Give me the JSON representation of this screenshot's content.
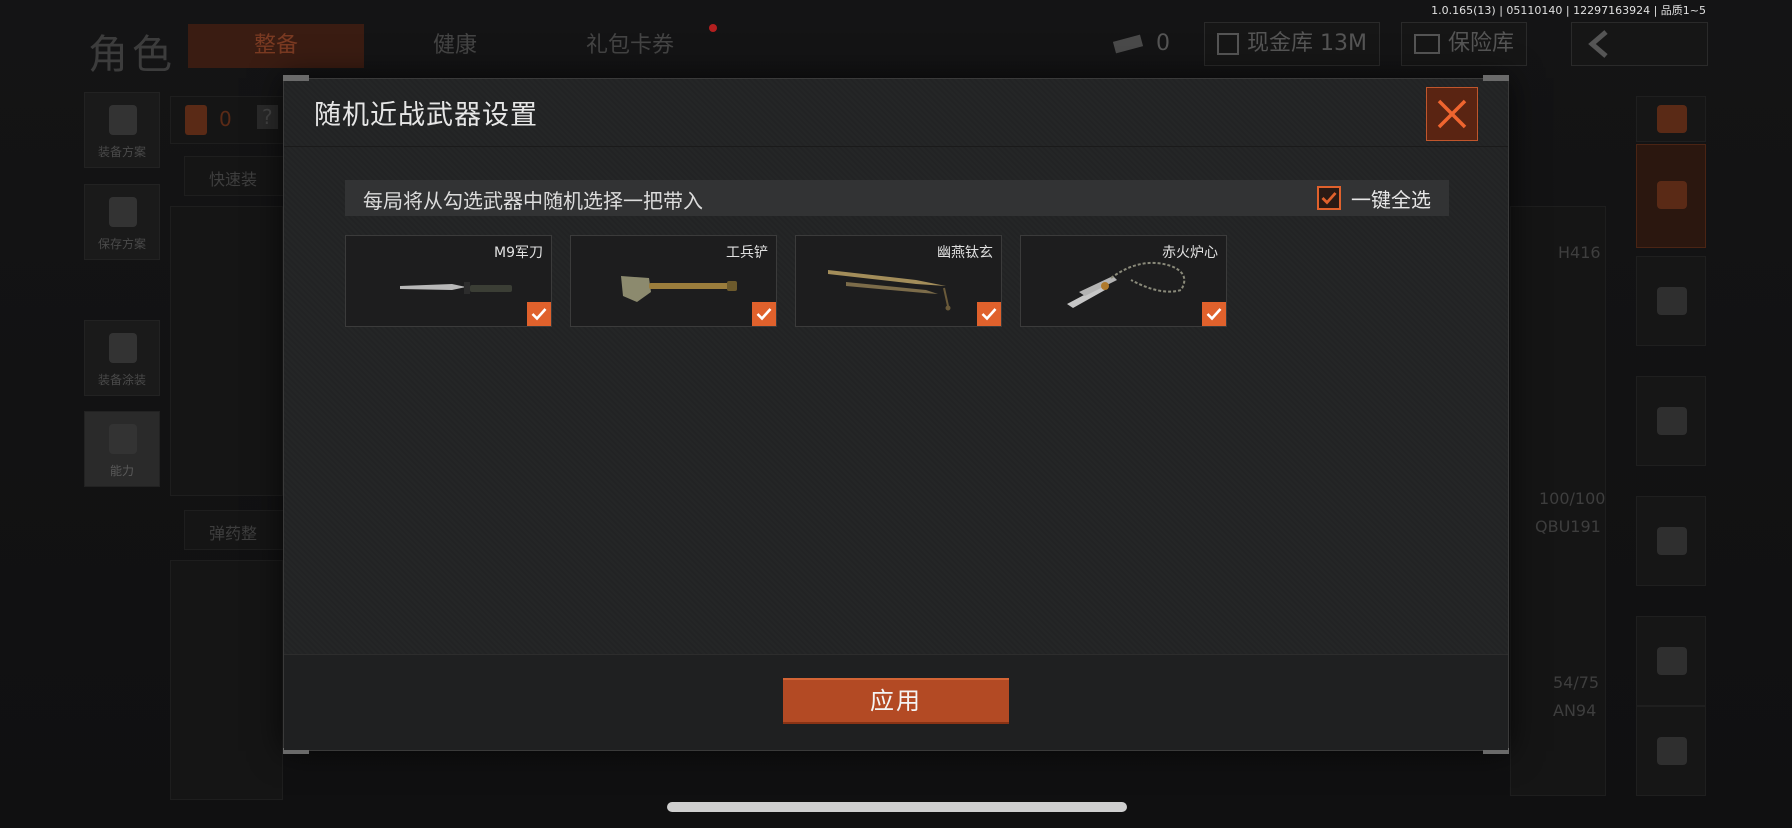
{
  "status_bar": {
    "build_info": "1.0.165(13) | 05110140 | 12297163924 | 品质1~5"
  },
  "background": {
    "page_title": "角色",
    "tabs": [
      {
        "label": "整备",
        "active": true
      },
      {
        "label": "健康",
        "active": false
      },
      {
        "label": "礼包卡券",
        "active": false,
        "has_dot": true
      }
    ],
    "currency_count": "0",
    "cash_vault": "现金库 13M",
    "safe_box": "保险库",
    "left_rail": [
      "装备方案",
      "保存方案",
      "装备涂装",
      "能力"
    ],
    "quick_label": "快速装",
    "ammo_label": "弹药整",
    "backpack_count": "0",
    "help_glyph": "?",
    "right_labels": [
      "H416",
      "100/100",
      "QBU191",
      "54/75",
      "AN94"
    ]
  },
  "modal": {
    "title": "随机近战武器设置",
    "info_text": "每局将从勾选武器中随机选择一把带入",
    "select_all_label": "一键全选",
    "select_all_checked": true,
    "weapons": [
      {
        "name": "M9军刀",
        "checked": true
      },
      {
        "name": "工兵铲",
        "checked": true
      },
      {
        "name": "幽燕钛玄",
        "checked": true
      },
      {
        "name": "赤火炉心",
        "checked": true
      }
    ],
    "apply_label": "应用"
  },
  "colors": {
    "accent": "#e0612c",
    "button": "#b34a24",
    "panel": "#222324"
  }
}
